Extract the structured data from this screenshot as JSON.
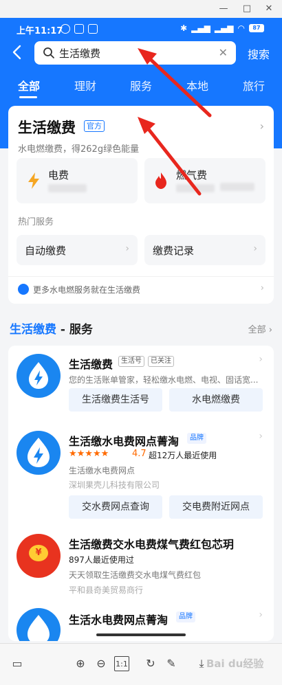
{
  "window": {
    "minimize": "—",
    "restore": "□",
    "close": "✕"
  },
  "status_bar": {
    "time": "上午11:17",
    "battery": "87"
  },
  "search": {
    "query": "生活缴费",
    "clear": "✕",
    "button": "搜索"
  },
  "tabs": [
    {
      "label": "全部",
      "active": true
    },
    {
      "label": "理财"
    },
    {
      "label": "服务"
    },
    {
      "label": "本地"
    },
    {
      "label": "旅行"
    }
  ],
  "top_card": {
    "title": "生活缴费",
    "badge": "官方",
    "subtitle": "水电燃缴费，得262g绿色能量",
    "bills": [
      {
        "name": "电费",
        "icon": "lightning-icon"
      },
      {
        "name": "燃气费",
        "icon": "flame-icon"
      }
    ],
    "hot_label": "热门服务",
    "services": [
      {
        "label": "自动缴费"
      },
      {
        "label": "缴费记录"
      }
    ],
    "footer": "更多水电燃服务就在生活缴费"
  },
  "section": {
    "highlight": "生活缴费",
    "rest": " - 服务",
    "all": "全部"
  },
  "results": [
    {
      "name": "生活缴费",
      "tags": [
        "生活号",
        "已关注"
      ],
      "desc": "您的生活账单管家，轻松缴水电燃、电视、固话宽...",
      "buttons": [
        "生活缴费生活号",
        "水电燃缴费"
      ]
    },
    {
      "name": "生活缴水电费网点菁淘",
      "tags": [
        "品牌"
      ],
      "stars": "★★★★★",
      "rating": "4.7",
      "users": "超12万人最近使用",
      "desc": "生活缴水电费网点",
      "company": "深圳果壳儿科技有限公司",
      "buttons": [
        "交水费网点查询",
        "交电费附近网点"
      ]
    },
    {
      "name": "生活缴费交水电费煤气费红包芯玥",
      "users": "897人最近使用过",
      "desc": "天天领取生活缴费交水电煤气费红包",
      "company": "平和县奇美贸易商行"
    },
    {
      "name": "生活水电费网点菁淘",
      "tags": [
        "品牌"
      ]
    }
  ],
  "toolbar": {
    "watermark": "Bai du经验"
  },
  "colors": {
    "brand_blue": "#1677ff",
    "annotation_red": "#e8271e"
  }
}
